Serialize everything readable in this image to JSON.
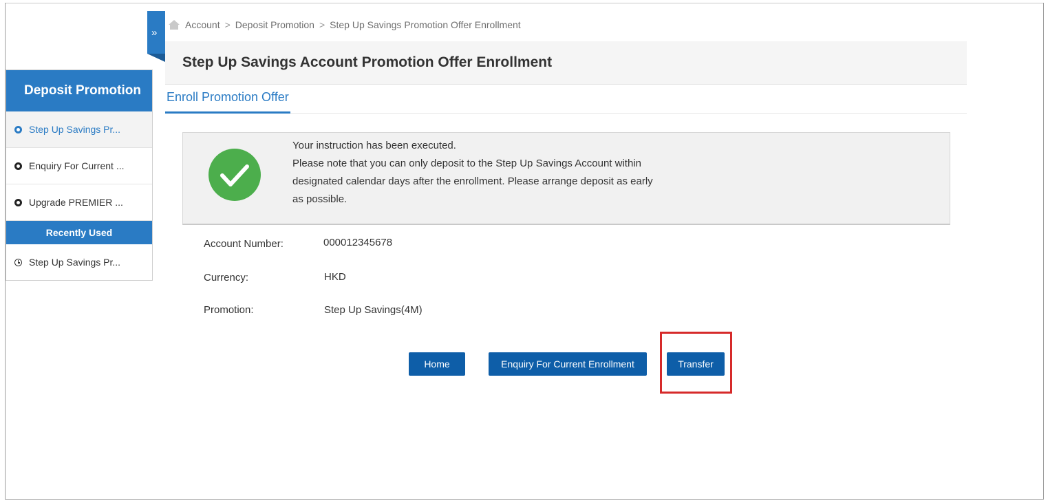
{
  "breadcrumb": [
    "Account",
    "Deposit Promotion",
    "Step Up Savings Promotion Offer Enrollment"
  ],
  "breadcrumb_separator": ">",
  "collapse_glyph": "»",
  "page_title": "Step Up Savings Account Promotion Offer Enrollment",
  "tab": "Enroll Promotion Offer",
  "sidebar": {
    "header": "Deposit Promotion",
    "items": [
      {
        "label": "Step Up Savings Pr...",
        "active": true
      },
      {
        "label": "Enquiry For Current ..."
      },
      {
        "label": "Upgrade PREMIER ..."
      }
    ],
    "recent_header": "Recently Used",
    "recent_items": [
      {
        "label": "Step Up Savings Pr..."
      }
    ]
  },
  "message": {
    "lines": [
      "Your instruction has been executed.",
      "Please note that you can only deposit to the Step Up Savings Account within",
      "designated calendar days after the enrollment. Please arrange deposit as early",
      "as possible."
    ]
  },
  "details": {
    "account_number_label": "Account Number:",
    "account_number": "000012345678",
    "currency_label": "Currency:",
    "currency": "HKD",
    "promotion_label": "Promotion:",
    "promotion": "Step Up Savings(4M)"
  },
  "buttons": {
    "home": "Home",
    "enquiry": "Enquiry For Current Enrollment",
    "transfer": "Transfer"
  },
  "colors": {
    "primary": "#2a7bc4",
    "button": "#0e5ea8",
    "success": "#4cae4c",
    "highlight": "#d62a2a"
  }
}
